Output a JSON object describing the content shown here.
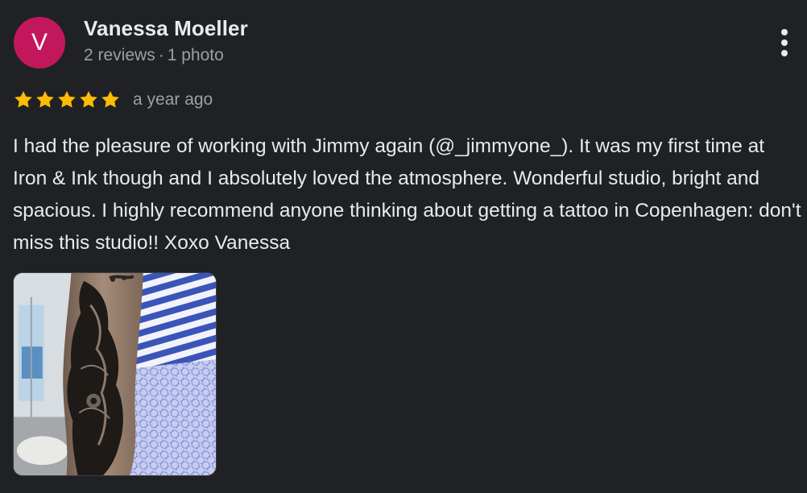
{
  "review": {
    "author": {
      "initial": "V",
      "name": "Vanessa Moeller",
      "reviews_count": "2 reviews",
      "photos_count": "1 photo",
      "separator": "·",
      "avatar_color": "#c2185b"
    },
    "rating": 5,
    "rating_max": 5,
    "star_color": "#fbbc04",
    "date": "a year ago",
    "text": "I had the pleasure of working with Jimmy again (@_jimmyone_). It was my first time at Iron & Ink though and I absolutely loved the atmosphere. Wonderful studio, bright and spacious. I highly recommend anyone thinking about getting a tattoo in Copenhagen: don't miss this studio!! Xoxo Vanessa",
    "more_icon": "more-vert-icon",
    "photo": {
      "icon": "tattoo-photo",
      "count": 1
    }
  }
}
